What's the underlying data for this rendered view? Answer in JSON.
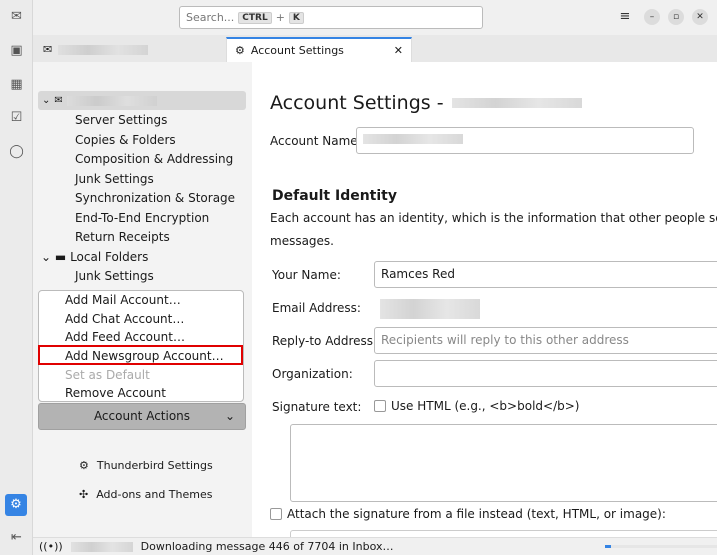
{
  "search": {
    "placeholder": "Search...",
    "kbd1": "CTRL",
    "plus": "+",
    "kbd2": "K"
  },
  "tabs": [
    {
      "label": ""
    },
    {
      "label": "Account Settings"
    }
  ],
  "tree": {
    "items": [
      "Server Settings",
      "Copies & Folders",
      "Composition & Addressing",
      "Junk Settings",
      "Synchronization & Storage",
      "End-To-End Encryption",
      "Return Receipts"
    ],
    "local": "Local Folders",
    "local_items": [
      "Junk Settings"
    ]
  },
  "menu": {
    "items": [
      "Add Mail Account…",
      "Add Chat Account…",
      "Add Feed Account…",
      "Add Newsgroup Account…",
      "Set as Default",
      "Remove Account"
    ]
  },
  "actions": {
    "label": "Account Actions"
  },
  "side_links": [
    "Thunderbird Settings",
    "Add-ons and Themes"
  ],
  "content": {
    "title": "Account Settings -",
    "account_name_label": "Account Name:",
    "default_identity": "Default Identity",
    "identity_desc_1": "Each account has an identity, which is the information that other people see when",
    "identity_desc_2": "messages.",
    "your_name_label": "Your Name:",
    "your_name_value": "Ramces Red",
    "email_label": "Email Address:",
    "reply_label": "Reply-to Address:",
    "reply_placeholder": "Recipients will reply to this other address",
    "org_label": "Organization:",
    "sig_label": "Signature text:",
    "use_html": "Use HTML (e.g., <b>bold</b>)",
    "attach": "Attach the signature from a file instead (text, HTML, or image):"
  },
  "status": {
    "text": "Downloading message 446 of 7704 in Inbox…",
    "progress": 0.058
  },
  "colors": {
    "accent": "#3584e4",
    "highlight": "#e00000"
  }
}
